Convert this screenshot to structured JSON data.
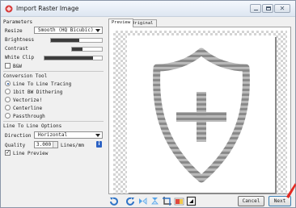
{
  "window": {
    "title": "Import Raster Image",
    "icon": "app-logo-icon",
    "controls": [
      "minimize-icon",
      "maximize-icon",
      "close-icon"
    ],
    "close_glyph": "✕"
  },
  "parameters": {
    "header": "Parameters",
    "resize_label": "Resize",
    "resize_value": "Smooth (HQ Bicubic)",
    "brightness_label": "Brightness",
    "brightness_level": 0.55,
    "contrast_label": "Contrast",
    "contrast_level": 0.35,
    "white_clip_label": "White Clip",
    "white_clip_level": 0.85,
    "bw_label": "B&W",
    "bw_checked": false
  },
  "conversion": {
    "header": "Conversion Tool",
    "options": [
      {
        "label": "Line To Line Tracing",
        "selected": true
      },
      {
        "label": "1bit BW Dithering",
        "selected": false
      },
      {
        "label": "Vectorize!",
        "selected": false
      },
      {
        "label": "Centerline",
        "selected": false
      },
      {
        "label": "Passthrough",
        "selected": false
      }
    ]
  },
  "line_options": {
    "header": "Line To Line Options",
    "direction_label": "Direction",
    "direction_value": "Horizontal",
    "quality_label": "Quality",
    "quality_value": "3.000",
    "quality_unit": "Lines/mm",
    "info_glyph": "i",
    "preview_label": "Line Preview",
    "preview_checked": true
  },
  "tabs": [
    {
      "label": "Preview",
      "active": true
    },
    {
      "label": "Original",
      "active": false
    }
  ],
  "preview": {
    "content": "shield-plus-icon",
    "stripe_color": "#8a8a8a",
    "stripe_alt_color": "#b8b8b8"
  },
  "toolbar": {
    "tools": [
      "rotate-left-icon",
      "rotate-right-icon",
      "flip-horizontal-icon",
      "flip-vertical-icon",
      "crop-icon",
      "invert-colors-icon",
      "filter-icon"
    ]
  },
  "buttons": {
    "cancel": "Cancel",
    "next": "Next"
  },
  "accent": "#1a4f9a"
}
